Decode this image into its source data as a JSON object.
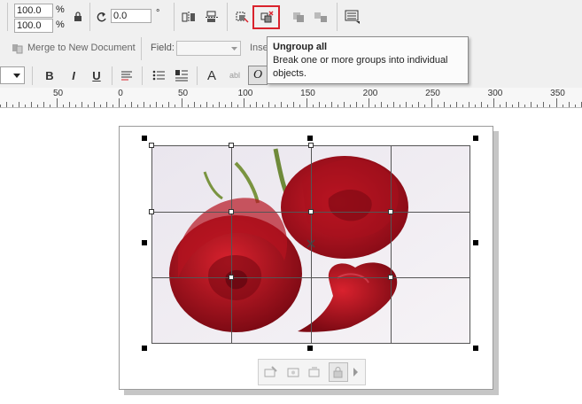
{
  "property_bar": {
    "scale_x": "100.0",
    "scale_y": "100.0",
    "percent_symbol": "%",
    "rotation": "0.0",
    "degree_symbol": "°"
  },
  "merge_bar": {
    "merge_label": "Merge to New Document",
    "field_label": "Field:",
    "insert_label": "Inse"
  },
  "tooltip": {
    "title": "Ungroup all",
    "description": "Break one or more groups into individual objects."
  },
  "ruler": {
    "labels": [
      "50",
      "0",
      "50",
      "100",
      "150",
      "200",
      "250",
      "300",
      "350"
    ]
  },
  "icons": {
    "lock": "lock-icon",
    "rotate": "rotate-icon",
    "mirror_h": "mirror-horizontal-icon",
    "mirror_v": "mirror-vertical-icon",
    "group": "group-icon",
    "ungroup_all": "ungroup-all-icon",
    "combine": "combine-icon",
    "break_apart": "break-apart-icon",
    "wrap": "wrap-paragraph-icon"
  },
  "colors": {
    "highlight": "#d9232d",
    "rose": "#b3121f"
  }
}
